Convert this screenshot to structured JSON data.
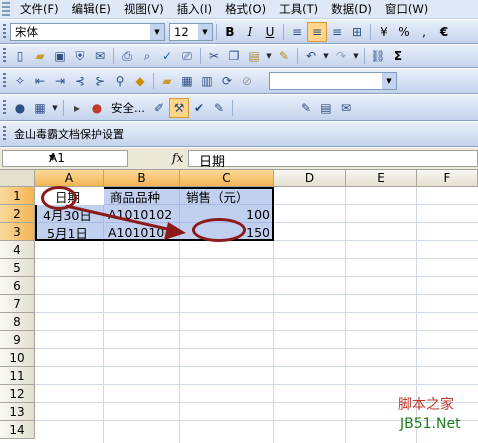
{
  "menubar": {
    "items": [
      "文件(F)",
      "编辑(E)",
      "视图(V)",
      "插入(I)",
      "格式(O)",
      "工具(T)",
      "数据(D)",
      "窗口(W)"
    ]
  },
  "format_toolbar": {
    "font_name": "宋体",
    "font_size": "12",
    "bold_label": "B",
    "italic_label": "I",
    "underline_label": "U",
    "percent_label": "%",
    "comma_label": ",",
    "currency_label": "€"
  },
  "security_toolbar": {
    "security_label": "安全..."
  },
  "jinshan_toolbar": {
    "title": "金山毒霸文档保护设置"
  },
  "formula_bar": {
    "name_box": "A1",
    "fx_label": "fx",
    "content": "日期"
  },
  "sheet": {
    "columns": [
      "A",
      "B",
      "C",
      "D",
      "E",
      "F"
    ],
    "rows": [
      "1",
      "2",
      "3",
      "4",
      "5",
      "6",
      "7",
      "8",
      "9",
      "10",
      "11",
      "12",
      "13",
      "14"
    ],
    "cells": {
      "A1": "日期",
      "B1": "商品品种",
      "C1": "销售（元）",
      "A2": "4月30日",
      "B2": "A1010102",
      "C2": "100",
      "A3": "5月1日",
      "B3": "A1010102",
      "C3": "150"
    }
  },
  "colors": {
    "annotation": "#8b1a1a",
    "selection": "#7896dc"
  },
  "watermark": {
    "site_name": "脚本之家",
    "site_url": "JB51.Net"
  }
}
